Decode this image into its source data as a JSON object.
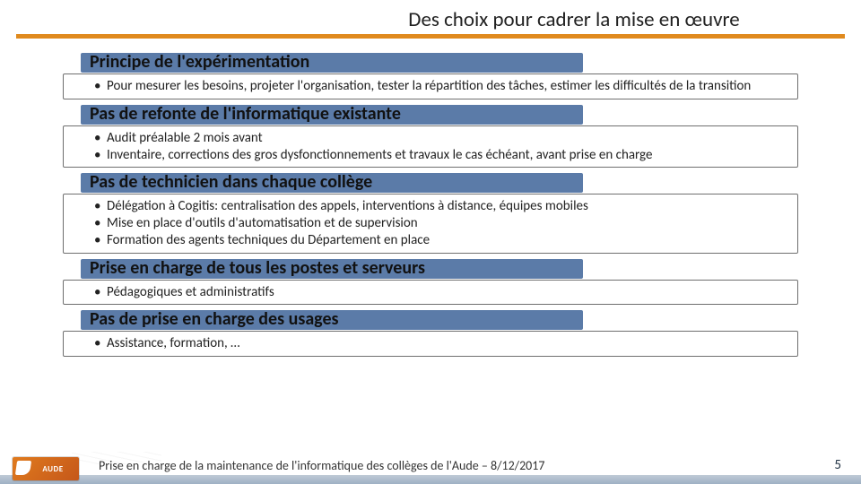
{
  "header": {
    "title": "Des choix pour cadrer la mise en œuvre"
  },
  "sections": [
    {
      "heading": "Principe de l'expérimentation",
      "bullets": [
        "Pour mesurer les besoins, projeter l'organisation, tester la répartition des tâches, estimer les difficultés de la transition"
      ]
    },
    {
      "heading": "Pas de refonte de l'informatique existante",
      "bullets": [
        "Audit préalable 2 mois avant",
        "Inventaire, corrections des gros dysfonctionnements et travaux le cas échéant, avant prise en charge"
      ]
    },
    {
      "heading": "Pas de technicien dans chaque collège",
      "bullets": [
        "Délégation à Cogitis: centralisation des appels, interventions à distance, équipes mobiles",
        "Mise en place d'outils d'automatisation et de supervision",
        "Formation des agents techniques du Département en place"
      ]
    },
    {
      "heading": "Prise en charge de tous les postes et serveurs",
      "bullets": [
        "Pédagogiques et administratifs"
      ]
    },
    {
      "heading": "Pas de prise en charge des usages",
      "bullets": [
        "Assistance, formation, …"
      ]
    }
  ],
  "footer": {
    "logo_text": "AUDE",
    "caption": "Prise en charge de la maintenance de l'informatique des collèges de l'Aude – 8/12/2017",
    "page": "5"
  }
}
